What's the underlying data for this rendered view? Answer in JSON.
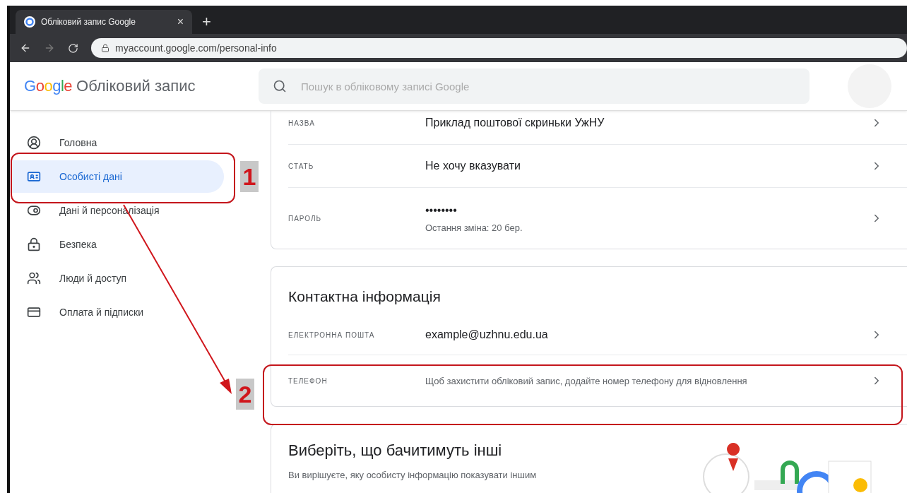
{
  "browser": {
    "tab_title": "Обліковий запис Google",
    "tab_close": "×",
    "new_tab": "+",
    "url": "myaccount.google.com/personal-info"
  },
  "header": {
    "logo": "Google",
    "product": "Обліковий запис",
    "search_placeholder": "Пошук в обліковому записі Google"
  },
  "sidebar": {
    "items": [
      {
        "label": "Головна",
        "selected": false
      },
      {
        "label": "Особисті дані",
        "selected": true
      },
      {
        "label": "Дані й персоналізація",
        "selected": false
      },
      {
        "label": "Безпека",
        "selected": false
      },
      {
        "label": "Люди й доступ",
        "selected": false
      },
      {
        "label": "Оплата й підписки",
        "selected": false
      }
    ]
  },
  "basic_info": {
    "rows": [
      {
        "label": "НАЗВА",
        "value": "Приклад поштової скриньки УжНУ"
      },
      {
        "label": "СТАТЬ",
        "value": "Не хочу вказувати"
      },
      {
        "label": "ПАРОЛЬ",
        "value": "••••••••",
        "note": "Остання зміна: 20 бер."
      }
    ]
  },
  "contact_info": {
    "title": "Контактна інформація",
    "rows": [
      {
        "label": "ЕЛЕКТРОННА ПОШТА",
        "value": "example@uzhnu.edu.ua",
        "kind": "value"
      },
      {
        "label": "ТЕЛЕФОН",
        "value": "Щоб захистити обліковий запис, додайте номер телефону для відновлення",
        "kind": "hint"
      }
    ]
  },
  "visibility": {
    "title": "Виберіть, що бачитимуть інші",
    "text": "Ви вирішуєте, яку особисту інформацію показувати іншим"
  },
  "annotations": [
    {
      "number": "1"
    },
    {
      "number": "2"
    }
  ]
}
